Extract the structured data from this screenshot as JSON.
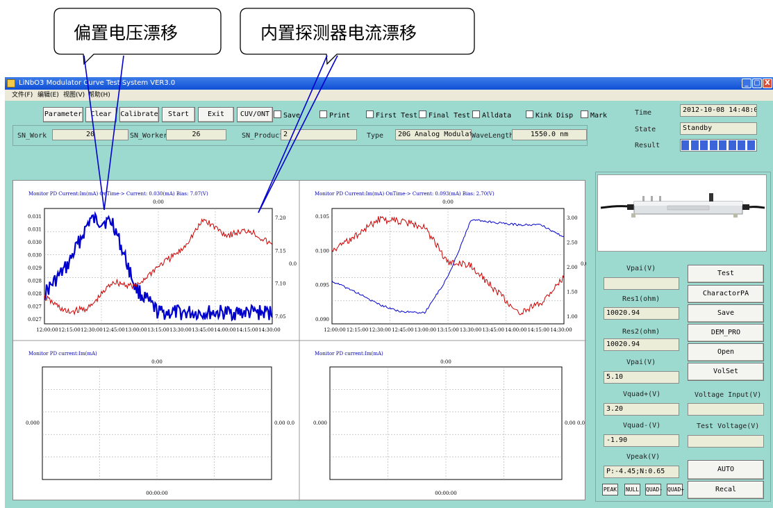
{
  "callouts": {
    "left": "偏置电压漂移",
    "right": "内置探测器电流漂移"
  },
  "window": {
    "title": "LiNbO3 Modulator Curve Test System  VER3.0",
    "buttons": {
      "minimize": "_",
      "maximize": "▢",
      "close": "X"
    }
  },
  "menu": [
    "文件(F)",
    "编辑(E)",
    "视图(V)",
    "帮助(H)"
  ],
  "toolbar": {
    "buttons": [
      "Parameter",
      "Clear",
      "Calibrate",
      "Start",
      "Exit",
      "CUV/ONT"
    ],
    "checkboxes": [
      "Save",
      "Print",
      "First Test",
      "Final Test",
      "Alldata",
      "Kink Disp",
      "Mark"
    ]
  },
  "status": {
    "time_label": "Time",
    "time_value": "2012-10-08 14:48:09",
    "state_label": "State",
    "state_value": "Standby",
    "result_label": "Result",
    "result_segments": 8
  },
  "info": {
    "sn_work_label": "SN_Work",
    "sn_work_value": "20",
    "sn_worker_label": "SN_Worker",
    "sn_worker_value": "26",
    "sn_product_label": "SN_Product",
    "sn_product_value": "2",
    "type_label": "Type",
    "type_value": "20G Analog Modulato",
    "wavelength_label": "WaveLength",
    "wavelength_value": "1550.0 nm"
  },
  "right_panel": {
    "vpai1_label": "Vpai(V)",
    "vpai1_value": "",
    "res1_label": "Res1(ohm)",
    "res1_value": "10020.94",
    "res2_label": "Res2(ohm)",
    "res2_value": "10020.94",
    "vpai2_label": "Vpai(V)",
    "vpai2_value": "5.10",
    "vquad_plus_label": "Vquad+(V)",
    "vquad_plus_value": "3.20",
    "vquad_minus_label": "Vquad-(V)",
    "vquad_minus_value": "-1.90",
    "vpeak_label": "Vpeak(V)",
    "vpeak_value": "P:-4.45;N:0.65",
    "voltage_input_label": "Voltage Input(V)",
    "voltage_input_value": "",
    "test_voltage_label": "Test Voltage(V)",
    "test_voltage_value": "",
    "buttons": [
      "Test",
      "CharactorPA",
      "Save",
      "DEM_PRO",
      "Open",
      "VolSet",
      "AUTO",
      "Recal"
    ],
    "small_buttons": [
      "PEAK",
      "NULL",
      "QUAD-",
      "QUAD+"
    ]
  },
  "chart_data": [
    {
      "type": "line",
      "header": "Monitor PD Current:Im(mA)      OnTime-> Current:  0.030(mA)        Bias:  7.07(V)",
      "top_label": "0:00",
      "x": [
        "12:00:00",
        "12:15:00",
        "12:30:00",
        "12:45:00",
        "13:00:00",
        "13:15:00",
        "13:30:00",
        "13:45:00",
        "14:00:00",
        "14:15:00",
        "14:30:00"
      ],
      "left_ticks": [
        "0.031",
        "0.031",
        "0.030",
        "0.030",
        "0.029",
        "0.028",
        "0.028",
        "0.027",
        "0.027"
      ],
      "right_ticks": [
        "7.20",
        "7.15",
        "7.10",
        "7.05"
      ],
      "right_side_label": "0.0",
      "series": [
        {
          "color": "#0000cc",
          "values": [
            0.0283,
            0.0293,
            0.031,
            0.0309,
            0.0285,
            0.0276,
            0.0276,
            0.0276,
            0.0276,
            0.0276,
            0.0276
          ]
        },
        {
          "color": "#cc0000",
          "values": [
            7.06,
            7.03,
            7.04,
            7.09,
            7.08,
            7.12,
            7.15,
            7.21,
            7.18,
            7.19,
            7.16
          ]
        }
      ]
    },
    {
      "type": "line",
      "header": "Monitor PD Current:Im(mA)      OnTime-> Current:  0.093(mA)        Bias:  2.70(V)",
      "top_label": "0:00",
      "x": [
        "12:00:00",
        "12:15:00",
        "12:30:00",
        "12:45:00",
        "13:00:00",
        "13:15:00",
        "13:30:00",
        "13:45:00",
        "14:00:00",
        "14:15:00",
        "14:30:00"
      ],
      "left_ticks": [
        "0.105",
        "0.100",
        "0.095",
        "0.090"
      ],
      "right_ticks": [
        "3.00",
        "2.50",
        "2.00",
        "1.50",
        "1.00"
      ],
      "right_side_label": "0.0",
      "series": [
        {
          "color": "#0000cc",
          "values": [
            1.75,
            1.5,
            1.2,
            1.02,
            1.0,
            1.85,
            3.22,
            3.15,
            3.1,
            3.1,
            2.8
          ]
        },
        {
          "color": "#cc0000",
          "values": [
            0.0995,
            0.102,
            0.1048,
            0.1045,
            0.1035,
            0.0975,
            0.097,
            0.093,
            0.089,
            0.0905,
            0.095
          ]
        }
      ]
    },
    {
      "type": "line",
      "header": "Monitor PD current:Im(mA)",
      "top_label": "0:00",
      "left_tick": "0.000",
      "right_tick": "0.00",
      "right_side_label": "0.0",
      "bottom_label": "00:00:00",
      "series": []
    },
    {
      "type": "line",
      "header": "Monitor PD current:Im(mA)",
      "top_label": "0:00",
      "left_tick": "0.000",
      "right_tick": "0.00",
      "right_side_label": "0.0",
      "bottom_label": "00:00:00",
      "series": []
    }
  ]
}
